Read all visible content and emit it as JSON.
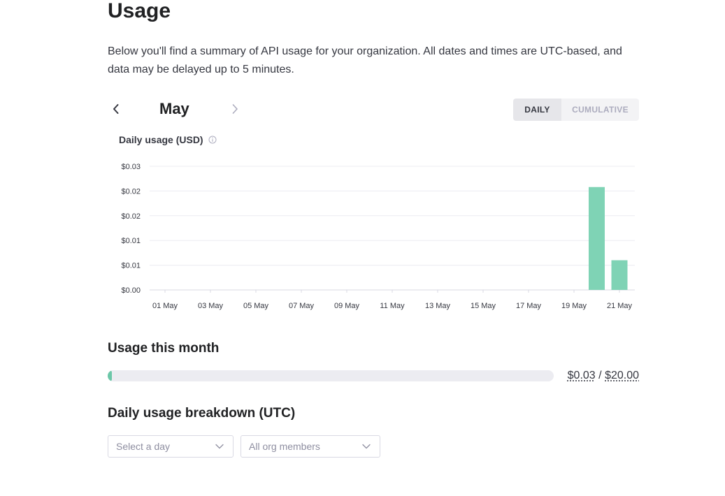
{
  "page": {
    "title": "Usage",
    "intro": "Below you'll find a summary of API usage for your organization. All dates and times are UTC-based, and data may be delayed up to 5 minutes."
  },
  "month_nav": {
    "month": "May",
    "prev_icon": "chevron-left-icon",
    "next_icon": "chevron-right-icon"
  },
  "view_toggle": {
    "daily": "DAILY",
    "cumulative": "CUMULATIVE",
    "selected": "DAILY"
  },
  "chart_title": "Daily usage (USD)",
  "chart_data": {
    "type": "bar",
    "title": "Daily usage (USD)",
    "ytick_labels": [
      "$0.00",
      "$0.01",
      "$0.01",
      "$0.02",
      "$0.02",
      "$0.03"
    ],
    "ylim": [
      0,
      0.025
    ],
    "xtick_labels": [
      "01 May",
      "03 May",
      "05 May",
      "07 May",
      "09 May",
      "11 May",
      "13 May",
      "15 May",
      "17 May",
      "19 May",
      "21 May"
    ],
    "categories": [
      "01 May",
      "02 May",
      "03 May",
      "04 May",
      "05 May",
      "06 May",
      "07 May",
      "08 May",
      "09 May",
      "10 May",
      "11 May",
      "12 May",
      "13 May",
      "14 May",
      "15 May",
      "16 May",
      "17 May",
      "18 May",
      "19 May",
      "20 May",
      "21 May"
    ],
    "values": [
      0,
      0,
      0,
      0,
      0,
      0,
      0,
      0,
      0,
      0,
      0,
      0,
      0,
      0,
      0,
      0,
      0,
      0,
      0,
      0.0208,
      0.006
    ],
    "bar_color": "#7fd3b5",
    "grid": true
  },
  "usage_month": {
    "title": "Usage this month",
    "used": "$0.03",
    "separator": "/",
    "limit": "$20.00",
    "fraction": 0.0015,
    "bar_color": "#6cc7a8"
  },
  "breakdown": {
    "title": "Daily usage breakdown (UTC)",
    "day_select": "Select a day",
    "members_select": "All org members"
  }
}
